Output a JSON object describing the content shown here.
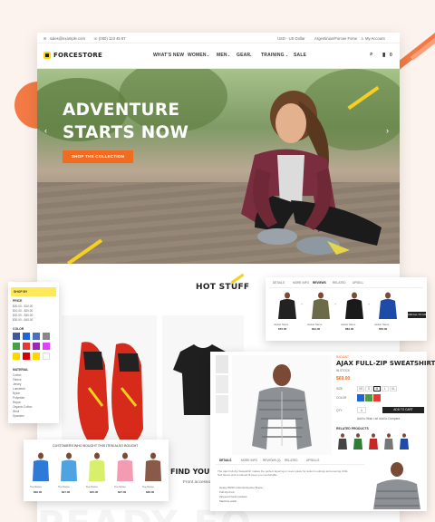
{
  "topbar": {
    "email": "sales@example.com",
    "phone": "(000) 123 45 67",
    "currency": "USD - US Dollar",
    "language": "Argentinian/Forcee Fome",
    "account": "My Account"
  },
  "brand": {
    "name": "FORCESTORE"
  },
  "menu": [
    {
      "label": "WHAT'S NEW"
    },
    {
      "label": "WOMEN"
    },
    {
      "label": "MEN"
    },
    {
      "label": "GEAR"
    },
    {
      "label": "TRAINING"
    },
    {
      "label": "SALE"
    }
  ],
  "cart": {
    "count": "0"
  },
  "hero": {
    "line1": "ADVENTURE",
    "line2": "STARTS NOW",
    "cta": "SHOP THE COLLECTION"
  },
  "section": {
    "title": "HOT STUFF"
  },
  "promo": {
    "title": "FIND YOUR I",
    "subtitle": "Front accessor"
  },
  "background_text": "PEADY FO",
  "filter": {
    "title": "SHOP BY",
    "price_label": "PRICE",
    "price_ranges": [
      "$00.00 - $10.00",
      "$10.00 - $20.00",
      "$20.00 - $30.00",
      "$30.00 - $40.00"
    ],
    "color_label": "COLOR",
    "colors": [
      "#3d5a98",
      "#1e66d8",
      "#4b6fb8",
      "#888888",
      "#43a047",
      "#e53935",
      "#9c27b0",
      "#e040fb",
      "#ffd600",
      "#d50000",
      "#ffd600",
      "#ffffff"
    ],
    "material_label": "MATERIAL",
    "materials": [
      "Cotton",
      "Fleece",
      "Jersey",
      "Lumatech",
      "Nylon",
      "Polyester",
      "Rayon",
      "Organic Cotton",
      "Wool",
      "Spandex"
    ]
  },
  "related": {
    "tabs": [
      "DETAILS",
      "MORE INFO",
      "REVIEWS",
      "RELATED",
      "UPSELL"
    ],
    "products": [
      {
        "name": "Jacket Name",
        "price": "$70.00",
        "color": "#222222"
      },
      {
        "name": "Jacket Name",
        "price": "$64.00",
        "color": "#6b6b4a"
      },
      {
        "name": "Jacket Name",
        "price": "$82.00",
        "color": "#1a1a1a"
      },
      {
        "name": "Jacket Name",
        "price": "$56.00",
        "color": "#1e4aa8"
      }
    ],
    "action": "ADD ALL TO CART"
  },
  "customers": {
    "title": "CUSTOMERS WHO BOUGHT THIS ITEM ALSO BOUGHT",
    "products": [
      {
        "name": "Tee Name",
        "price": "$36.00",
        "color": "#2f7ad6"
      },
      {
        "name": "Tee Name",
        "price": "$27.00",
        "color": "#4fa3e0"
      },
      {
        "name": "Tee Name",
        "price": "$45.00",
        "color": "#d7ef6a"
      },
      {
        "name": "Tee Name",
        "price": "$27.00",
        "color": "#f29bb3"
      },
      {
        "name": "Tee Name",
        "price": "$36.00",
        "color": "#8a5a48"
      }
    ]
  },
  "detail": {
    "brand": "RADIANT",
    "title": "AJAX FULL-ZIP SWEATSHIRT",
    "stock": "IN STOCK",
    "price": "$69.00",
    "size_label": "SIZE",
    "sizes": [
      "XS",
      "S",
      "M",
      "L",
      "XL"
    ],
    "color_label": "COLOR",
    "colors": [
      "#1e66d8",
      "#43a047",
      "#e53935"
    ],
    "qty_label": "QTY",
    "qty": "1",
    "add_to_cart": "ADD TO CART",
    "wishlist": "Add to Wish List",
    "compare": "Add to Compare",
    "related_label": "RELATED PRODUCTS",
    "tabs": [
      "DETAILS",
      "MORE INFO",
      "REVIEWS (3)",
      "RELATED",
      "UPSELLS"
    ],
    "description": "The Ajax Full-Zip Sweatshirt makes the perfect layering or cover-piece for autumn outings and evening chills. Soft fleece and a relaxed fit keep you comfortable.",
    "bullets": [
      "Heavy 80/20 cotton/polyester fleece.",
      "Full-zip front.",
      "Zippered hand pockets.",
      "Machine wash."
    ]
  }
}
